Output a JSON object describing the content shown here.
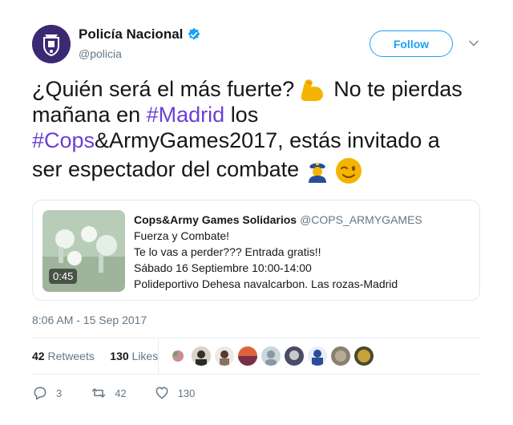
{
  "author": {
    "name": "Policía Nacional",
    "handle": "@policia",
    "follow_label": "Follow"
  },
  "tweet": {
    "line1_text": "¿Quién será el más fuerte?",
    "line1_after": "No te pierdas",
    "line2_text": "mañana en",
    "line2_hashtag": "#Madrid",
    "line2_after": "los",
    "line3_hashtag": "#Cops",
    "line3_after": "&ArmyGames2017, estás invitado a",
    "line4_text": "ser espectador del combate"
  },
  "card": {
    "name": "Cops&Army Games Solidarios",
    "handle": "@COPS_ARMYGAMES",
    "duration": "0:45",
    "lines": [
      "Fuerza y Combate!",
      "Te lo vas a perder??? Entrada gratis!!",
      "Sábado 16 Septiembre 10:00-14:00",
      "Polideportivo Dehesa navalcarbon. Las rozas-Madrid"
    ]
  },
  "timestamp": "8:06 AM - 15 Sep 2017",
  "stats": {
    "retweets_count": "42",
    "retweets_label": "Retweets",
    "likes_count": "130",
    "likes_label": "Likes"
  },
  "actions": {
    "reply_count": "3",
    "retweet_count": "42",
    "like_count": "130"
  },
  "colors": {
    "link": "#1da1f2",
    "hashtag": "#6b3fd6",
    "verified": "#1da1f2"
  }
}
